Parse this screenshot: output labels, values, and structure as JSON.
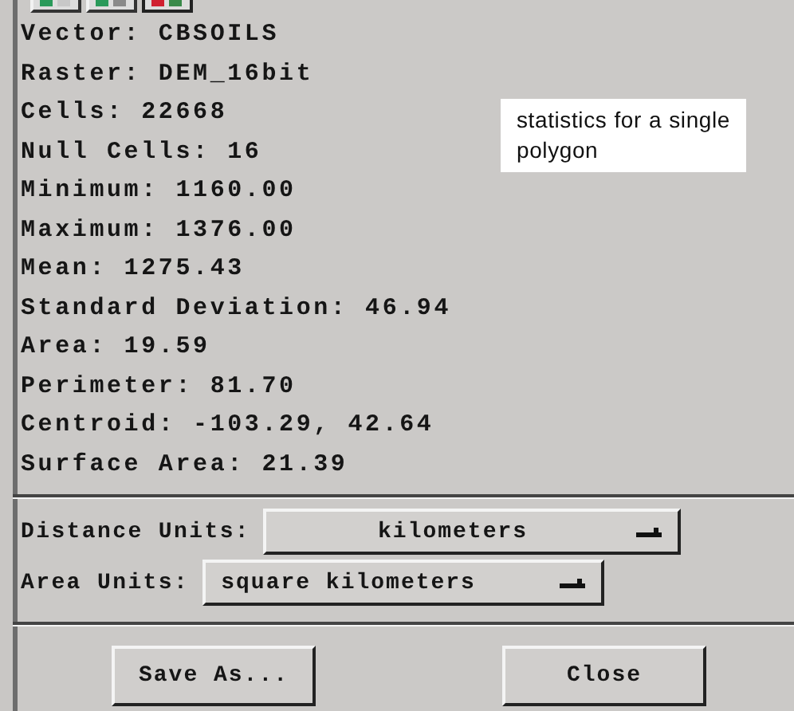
{
  "stats": [
    {
      "label": "Vector:",
      "value": "CBSOILS"
    },
    {
      "label": "Raster:",
      "value": "DEM_16bit"
    },
    {
      "label": "Cells:",
      "value": "22668"
    },
    {
      "label": "Null Cells:",
      "value": "16"
    },
    {
      "label": "Minimum:",
      "value": "1160.00"
    },
    {
      "label": "Maximum:",
      "value": "1376.00"
    },
    {
      "label": "Mean:",
      "value": "1275.43"
    },
    {
      "label": "Standard Deviation:",
      "value": "46.94"
    },
    {
      "label": "Area:",
      "value": "19.59"
    },
    {
      "label": "Perimeter:",
      "value": "81.70"
    },
    {
      "label": "Centroid:",
      "value": "-103.29, 42.64"
    },
    {
      "label": "Surface Area:",
      "value": "21.39"
    }
  ],
  "annotation": "statistics for a single polygon",
  "unit_fields": [
    {
      "label": "Distance Units:",
      "value": "kilometers",
      "kind": "wide"
    },
    {
      "label": "Area Units:",
      "value": "square kilometers",
      "kind": "narrow"
    }
  ],
  "buttons": [
    "Save As...",
    "Close"
  ]
}
